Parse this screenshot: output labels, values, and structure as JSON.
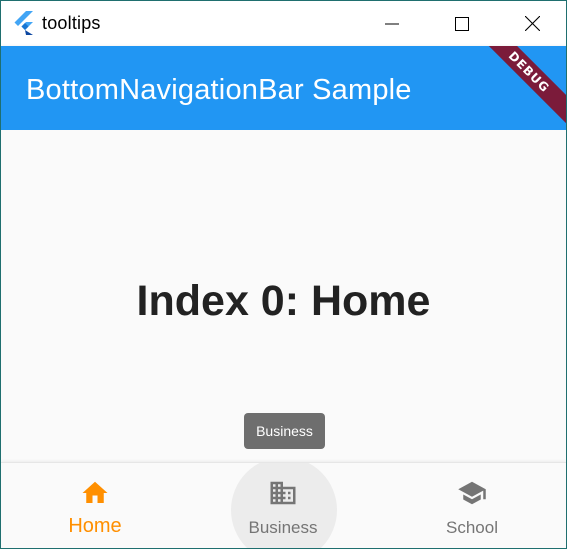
{
  "window": {
    "title": "tooltips"
  },
  "appbar": {
    "title": "BottomNavigationBar Sample",
    "background": "#2196f3",
    "debug_banner": "DEBUG"
  },
  "body": {
    "index_text": "Index 0: Home"
  },
  "tooltip": {
    "text": "Business"
  },
  "bottom_nav": {
    "selected_index": 0,
    "selected_color": "#ff8f00",
    "unselected_color": "#757575",
    "items": [
      {
        "label": "Home",
        "icon": "home-icon",
        "selected": true
      },
      {
        "label": "Business",
        "icon": "business-icon",
        "selected": false
      },
      {
        "label": "School",
        "icon": "school-icon",
        "selected": false
      }
    ]
  }
}
